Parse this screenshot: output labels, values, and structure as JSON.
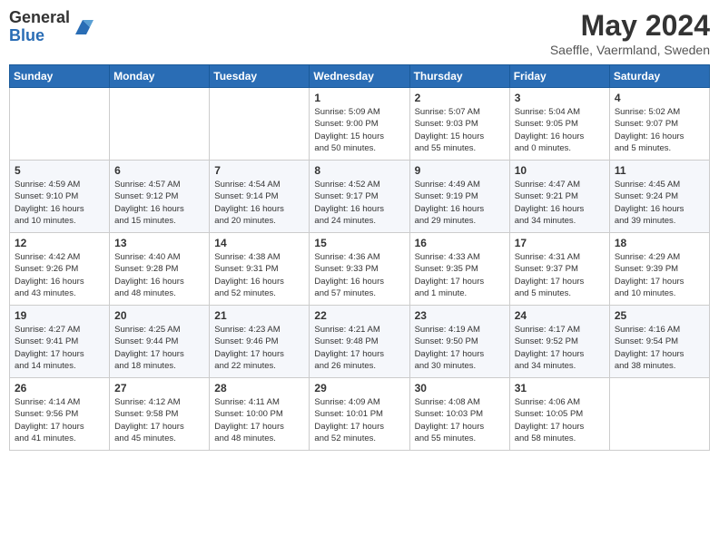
{
  "header": {
    "logo_line1": "General",
    "logo_line2": "Blue",
    "title": "May 2024",
    "subtitle": "Saeffle, Vaermland, Sweden"
  },
  "days_of_week": [
    "Sunday",
    "Monday",
    "Tuesday",
    "Wednesday",
    "Thursday",
    "Friday",
    "Saturday"
  ],
  "weeks": [
    [
      {
        "day": "",
        "info": ""
      },
      {
        "day": "",
        "info": ""
      },
      {
        "day": "",
        "info": ""
      },
      {
        "day": "1",
        "info": "Sunrise: 5:09 AM\nSunset: 9:00 PM\nDaylight: 15 hours\nand 50 minutes."
      },
      {
        "day": "2",
        "info": "Sunrise: 5:07 AM\nSunset: 9:03 PM\nDaylight: 15 hours\nand 55 minutes."
      },
      {
        "day": "3",
        "info": "Sunrise: 5:04 AM\nSunset: 9:05 PM\nDaylight: 16 hours\nand 0 minutes."
      },
      {
        "day": "4",
        "info": "Sunrise: 5:02 AM\nSunset: 9:07 PM\nDaylight: 16 hours\nand 5 minutes."
      }
    ],
    [
      {
        "day": "5",
        "info": "Sunrise: 4:59 AM\nSunset: 9:10 PM\nDaylight: 16 hours\nand 10 minutes."
      },
      {
        "day": "6",
        "info": "Sunrise: 4:57 AM\nSunset: 9:12 PM\nDaylight: 16 hours\nand 15 minutes."
      },
      {
        "day": "7",
        "info": "Sunrise: 4:54 AM\nSunset: 9:14 PM\nDaylight: 16 hours\nand 20 minutes."
      },
      {
        "day": "8",
        "info": "Sunrise: 4:52 AM\nSunset: 9:17 PM\nDaylight: 16 hours\nand 24 minutes."
      },
      {
        "day": "9",
        "info": "Sunrise: 4:49 AM\nSunset: 9:19 PM\nDaylight: 16 hours\nand 29 minutes."
      },
      {
        "day": "10",
        "info": "Sunrise: 4:47 AM\nSunset: 9:21 PM\nDaylight: 16 hours\nand 34 minutes."
      },
      {
        "day": "11",
        "info": "Sunrise: 4:45 AM\nSunset: 9:24 PM\nDaylight: 16 hours\nand 39 minutes."
      }
    ],
    [
      {
        "day": "12",
        "info": "Sunrise: 4:42 AM\nSunset: 9:26 PM\nDaylight: 16 hours\nand 43 minutes."
      },
      {
        "day": "13",
        "info": "Sunrise: 4:40 AM\nSunset: 9:28 PM\nDaylight: 16 hours\nand 48 minutes."
      },
      {
        "day": "14",
        "info": "Sunrise: 4:38 AM\nSunset: 9:31 PM\nDaylight: 16 hours\nand 52 minutes."
      },
      {
        "day": "15",
        "info": "Sunrise: 4:36 AM\nSunset: 9:33 PM\nDaylight: 16 hours\nand 57 minutes."
      },
      {
        "day": "16",
        "info": "Sunrise: 4:33 AM\nSunset: 9:35 PM\nDaylight: 17 hours\nand 1 minute."
      },
      {
        "day": "17",
        "info": "Sunrise: 4:31 AM\nSunset: 9:37 PM\nDaylight: 17 hours\nand 5 minutes."
      },
      {
        "day": "18",
        "info": "Sunrise: 4:29 AM\nSunset: 9:39 PM\nDaylight: 17 hours\nand 10 minutes."
      }
    ],
    [
      {
        "day": "19",
        "info": "Sunrise: 4:27 AM\nSunset: 9:41 PM\nDaylight: 17 hours\nand 14 minutes."
      },
      {
        "day": "20",
        "info": "Sunrise: 4:25 AM\nSunset: 9:44 PM\nDaylight: 17 hours\nand 18 minutes."
      },
      {
        "day": "21",
        "info": "Sunrise: 4:23 AM\nSunset: 9:46 PM\nDaylight: 17 hours\nand 22 minutes."
      },
      {
        "day": "22",
        "info": "Sunrise: 4:21 AM\nSunset: 9:48 PM\nDaylight: 17 hours\nand 26 minutes."
      },
      {
        "day": "23",
        "info": "Sunrise: 4:19 AM\nSunset: 9:50 PM\nDaylight: 17 hours\nand 30 minutes."
      },
      {
        "day": "24",
        "info": "Sunrise: 4:17 AM\nSunset: 9:52 PM\nDaylight: 17 hours\nand 34 minutes."
      },
      {
        "day": "25",
        "info": "Sunrise: 4:16 AM\nSunset: 9:54 PM\nDaylight: 17 hours\nand 38 minutes."
      }
    ],
    [
      {
        "day": "26",
        "info": "Sunrise: 4:14 AM\nSunset: 9:56 PM\nDaylight: 17 hours\nand 41 minutes."
      },
      {
        "day": "27",
        "info": "Sunrise: 4:12 AM\nSunset: 9:58 PM\nDaylight: 17 hours\nand 45 minutes."
      },
      {
        "day": "28",
        "info": "Sunrise: 4:11 AM\nSunset: 10:00 PM\nDaylight: 17 hours\nand 48 minutes."
      },
      {
        "day": "29",
        "info": "Sunrise: 4:09 AM\nSunset: 10:01 PM\nDaylight: 17 hours\nand 52 minutes."
      },
      {
        "day": "30",
        "info": "Sunrise: 4:08 AM\nSunset: 10:03 PM\nDaylight: 17 hours\nand 55 minutes."
      },
      {
        "day": "31",
        "info": "Sunrise: 4:06 AM\nSunset: 10:05 PM\nDaylight: 17 hours\nand 58 minutes."
      },
      {
        "day": "",
        "info": ""
      }
    ]
  ]
}
